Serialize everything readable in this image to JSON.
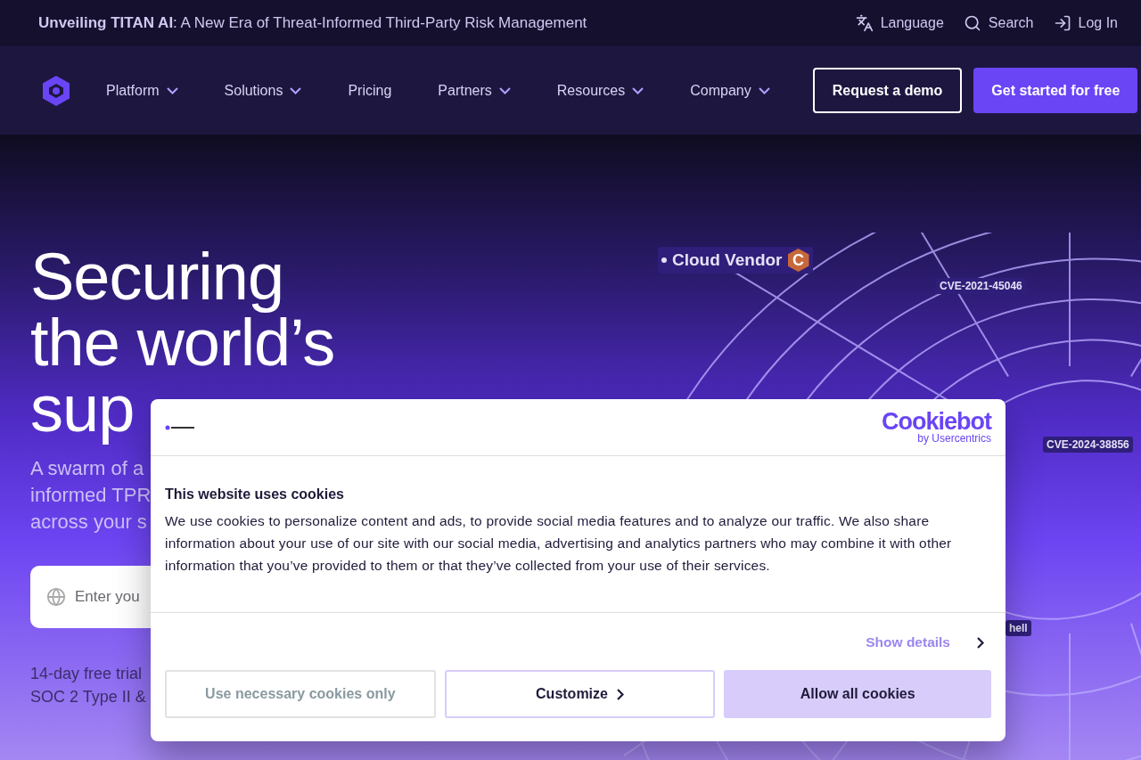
{
  "announcement": {
    "text": "**Unveiling TITAN AI**: A New Era of Threat-Informed Third-Party Risk Management",
    "links": [
      {
        "kind": "language",
        "label": "Language"
      },
      {
        "kind": "search",
        "label": "Search"
      },
      {
        "kind": "login",
        "label": "Log In"
      }
    ]
  },
  "nav": {
    "items": [
      {
        "label": "Platform",
        "dropdown": true
      },
      {
        "label": "Solutions",
        "dropdown": true
      },
      {
        "label": "Pricing",
        "dropdown": false
      },
      {
        "label": "Partners",
        "dropdown": true
      },
      {
        "label": "Resources",
        "dropdown": true
      },
      {
        "label": "Company",
        "dropdown": true
      }
    ],
    "buttons": [
      {
        "kind": "outline",
        "label": "Request a demo"
      },
      {
        "kind": "primary",
        "label": "Get started for free"
      }
    ]
  },
  "hero": {
    "heading": [
      "Securing",
      "the world’s",
      "sup"
    ],
    "subtitle": [
      "A swarm of a",
      "informed TPR",
      "across your s"
    ],
    "input": {
      "placeholder": "Enter you"
    },
    "notes": [
      "14-day free trial",
      "SOC 2 Type II &"
    ]
  },
  "graphic": {
    "labels": [
      {
        "kind": "vendor",
        "text": "Cloud Vendor",
        "badge": "C"
      },
      {
        "kind": "cve",
        "text": "CVE-2021-45046"
      },
      {
        "kind": "cve",
        "text": "CVE-2024-38856"
      },
      {
        "kind": "plain",
        "text": "hell"
      }
    ]
  },
  "cookie_dialog": {
    "brand": "Cookiebot",
    "brand_sub": "by Usercentrics",
    "title": "This website uses cookies",
    "body": "We use cookies to personalize content and ads, to provide social media features and to analyze our traffic. We also share information about your use of our site with our social media, advertising and analytics partners who may combine it with other information that you’ve provided to them or that they’ve collected from your use of their services.",
    "details_link": "Show details",
    "buttons": [
      {
        "kind": "outline",
        "label": "Use necessary cookies only"
      },
      {
        "kind": "customize",
        "label": "Customize"
      },
      {
        "kind": "fill",
        "label": "Allow all cookies"
      }
    ]
  }
}
